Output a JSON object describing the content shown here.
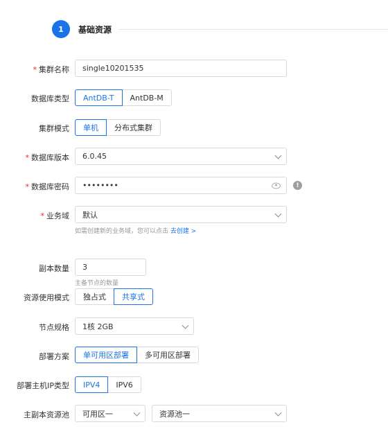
{
  "step": {
    "number": "1",
    "title": "基础资源"
  },
  "form": {
    "cluster_name": {
      "label": "集群名称",
      "value": "single10201535"
    },
    "db_type": {
      "label": "数据库类型",
      "options": [
        "AntDB-T",
        "AntDB-M"
      ],
      "selected": "AntDB-T"
    },
    "cluster_mode": {
      "label": "集群模式",
      "options": [
        "单机",
        "分布式集群"
      ],
      "selected": "单机"
    },
    "db_version": {
      "label": "数据库版本",
      "value": "6.0.45"
    },
    "db_password": {
      "label": "数据库密码",
      "value": "••••••••"
    },
    "business_domain": {
      "label": "业务域",
      "value": "默认",
      "hint": "如需创建新的业务域，您可以点击",
      "hint_link": "去创建 >"
    },
    "replica_count": {
      "label": "副本数量",
      "value": "3",
      "hint": "主备节点的数量"
    },
    "resource_mode": {
      "label": "资源使用模式",
      "options": [
        "独占式",
        "共享式"
      ],
      "selected": "共享式"
    },
    "node_spec": {
      "label": "节点规格",
      "value": "1核 2GB"
    },
    "deploy_plan": {
      "label": "部署方案",
      "options": [
        "单可用区部署",
        "多可用区部署"
      ],
      "selected": "单可用区部署"
    },
    "host_ip_type": {
      "label": "部署主机IP类型",
      "options": [
        "IPV4",
        "IPV6"
      ],
      "selected": "IPV4"
    },
    "resource_pool": {
      "label": "主副本资源池",
      "zone_value": "可用区一",
      "pool_value": "资源池一"
    }
  }
}
